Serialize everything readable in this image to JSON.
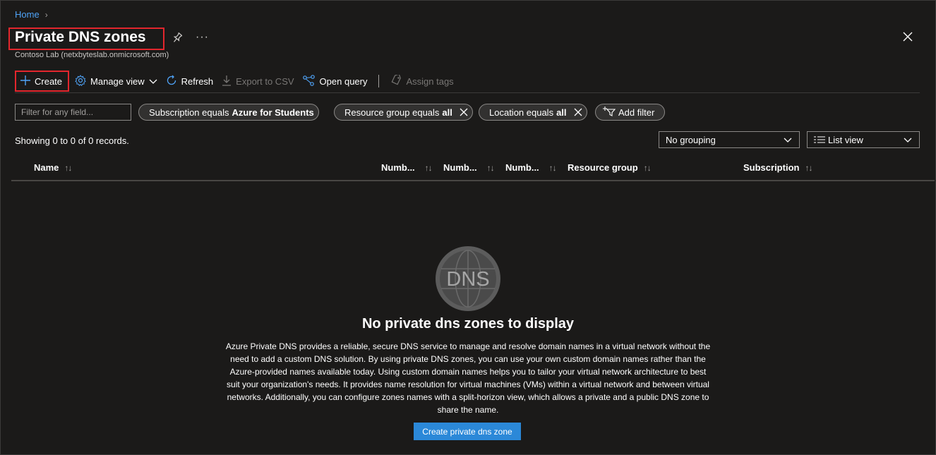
{
  "breadcrumb": {
    "home": "Home"
  },
  "header": {
    "title": "Private DNS zones",
    "subtitle": "Contoso Lab (netxbyteslab.onmicrosoft.com)",
    "more": "···"
  },
  "toolbar": {
    "create": "Create",
    "manage_view": "Manage view",
    "refresh": "Refresh",
    "export_csv": "Export to CSV",
    "open_query": "Open query",
    "assign_tags": "Assign tags"
  },
  "filters": {
    "search_placeholder": "Filter for any field...",
    "subscription": {
      "prefix": "Subscription equals",
      "value": "Azure for Students"
    },
    "resource_group": {
      "prefix": "Resource group equals",
      "value": "all"
    },
    "location": {
      "prefix": "Location equals",
      "value": "all"
    },
    "add_filter": "Add filter"
  },
  "records_text": "Showing 0 to 0 of 0 records.",
  "grouping": {
    "selected": "No grouping"
  },
  "view": {
    "selected": "List view"
  },
  "columns": [
    "Name",
    "Numb...",
    "Numb...",
    "Numb...",
    "Resource group",
    "Subscription"
  ],
  "empty_state": {
    "icon_text": "DNS",
    "title": "No private dns zones to display",
    "description": "Azure Private DNS provides a reliable, secure DNS service to manage and resolve domain names in a virtual network without the need to add a custom DNS solution. By using private DNS zones, you can use your own custom domain names rather than the Azure-provided names available today. Using custom domain names helps you to tailor your virtual network architecture to best suit your organization's needs. It provides name resolution for virtual machines (VMs) within a virtual network and between virtual networks. Additionally, you can configure zones names with a split-horizon view, which allows a private and a public DNS zone to share the name.",
    "button": "Create private dns zone"
  },
  "colors": {
    "accent": "#4fa3f7",
    "highlight": "#e3262d",
    "primary_button": "#2b88d8",
    "background": "#1b1a19"
  }
}
